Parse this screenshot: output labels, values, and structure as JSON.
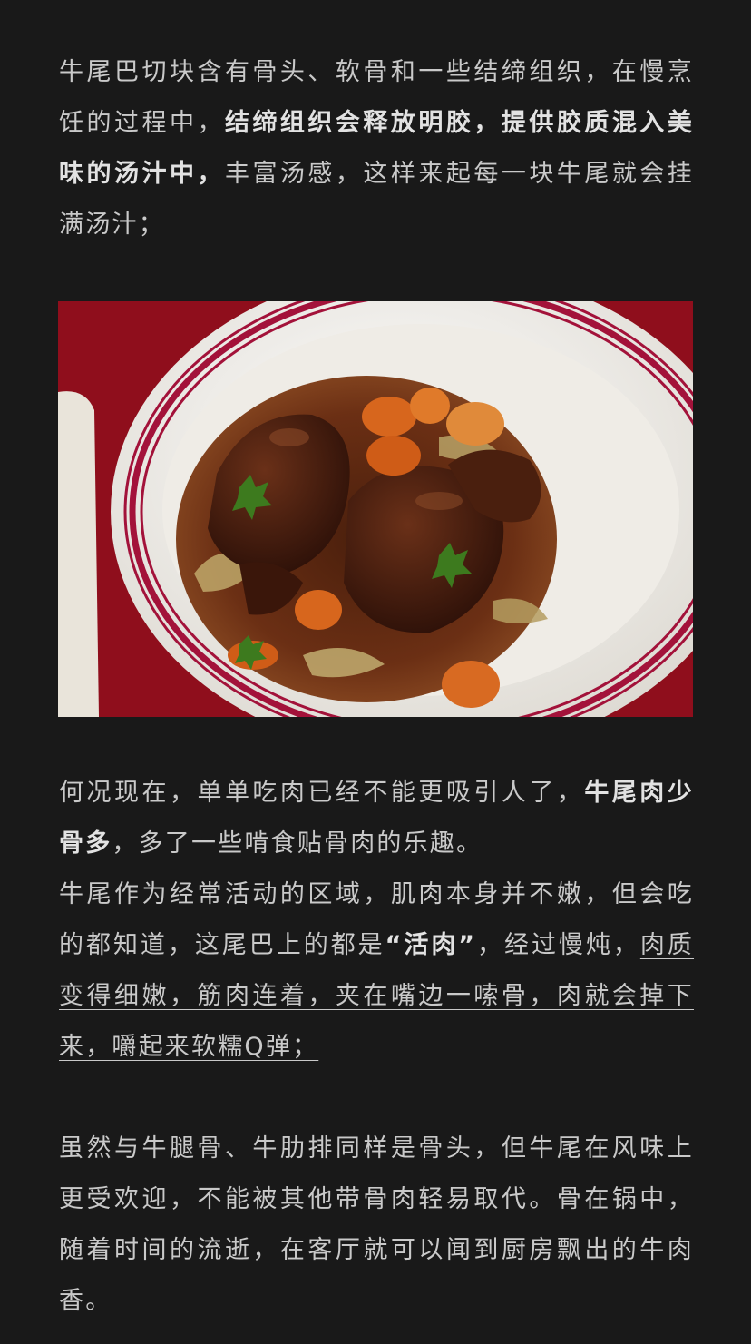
{
  "paragraph1": {
    "a": "牛尾巴切块含有骨头、软骨和一些结缔组织，在慢烹饪的过程中，",
    "b_bold": "结缔组织会释放明胶，提供胶质混入美味的汤汁中，",
    "c": "丰富汤感，这样来起每一块牛尾就会挂满汤汁；"
  },
  "photo": {
    "subject": "oxtail-stew-plate",
    "colors": {
      "tablecloth": "#9a1020",
      "plate": "#f3f1ec",
      "rim_stripe": "#a3123a",
      "sauce": "#6b2f14",
      "meat": "#3e1a0e",
      "carrot": "#d7661d",
      "parsley": "#3d7a1e"
    }
  },
  "paragraph2": {
    "a": "何况现在，单单吃肉已经不能更吸引人了，",
    "b_bold": "牛尾肉少骨多",
    "c": "，多了一些啃食贴骨肉的乐趣。"
  },
  "paragraph3": {
    "a": "牛尾作为经常活动的区域，肌肉本身并不嫩，但会吃的都知道，这尾巴上的都是",
    "b_bold": "“活肉”",
    "c": "，经过慢炖，",
    "d_underline": "肉质变得细嫩，筋肉连着，夹在嘴边一嗦骨，肉就会掉下来，嚼起来软糯Q弹；"
  },
  "paragraph4": {
    "text": "虽然与牛腿骨、牛肋排同样是骨头，但牛尾在风味上更受欢迎，不能被其他带骨肉轻易取代。骨在锅中，随着时间的流逝，在客厅就可以闻到厨房飘出的牛肉香。"
  }
}
